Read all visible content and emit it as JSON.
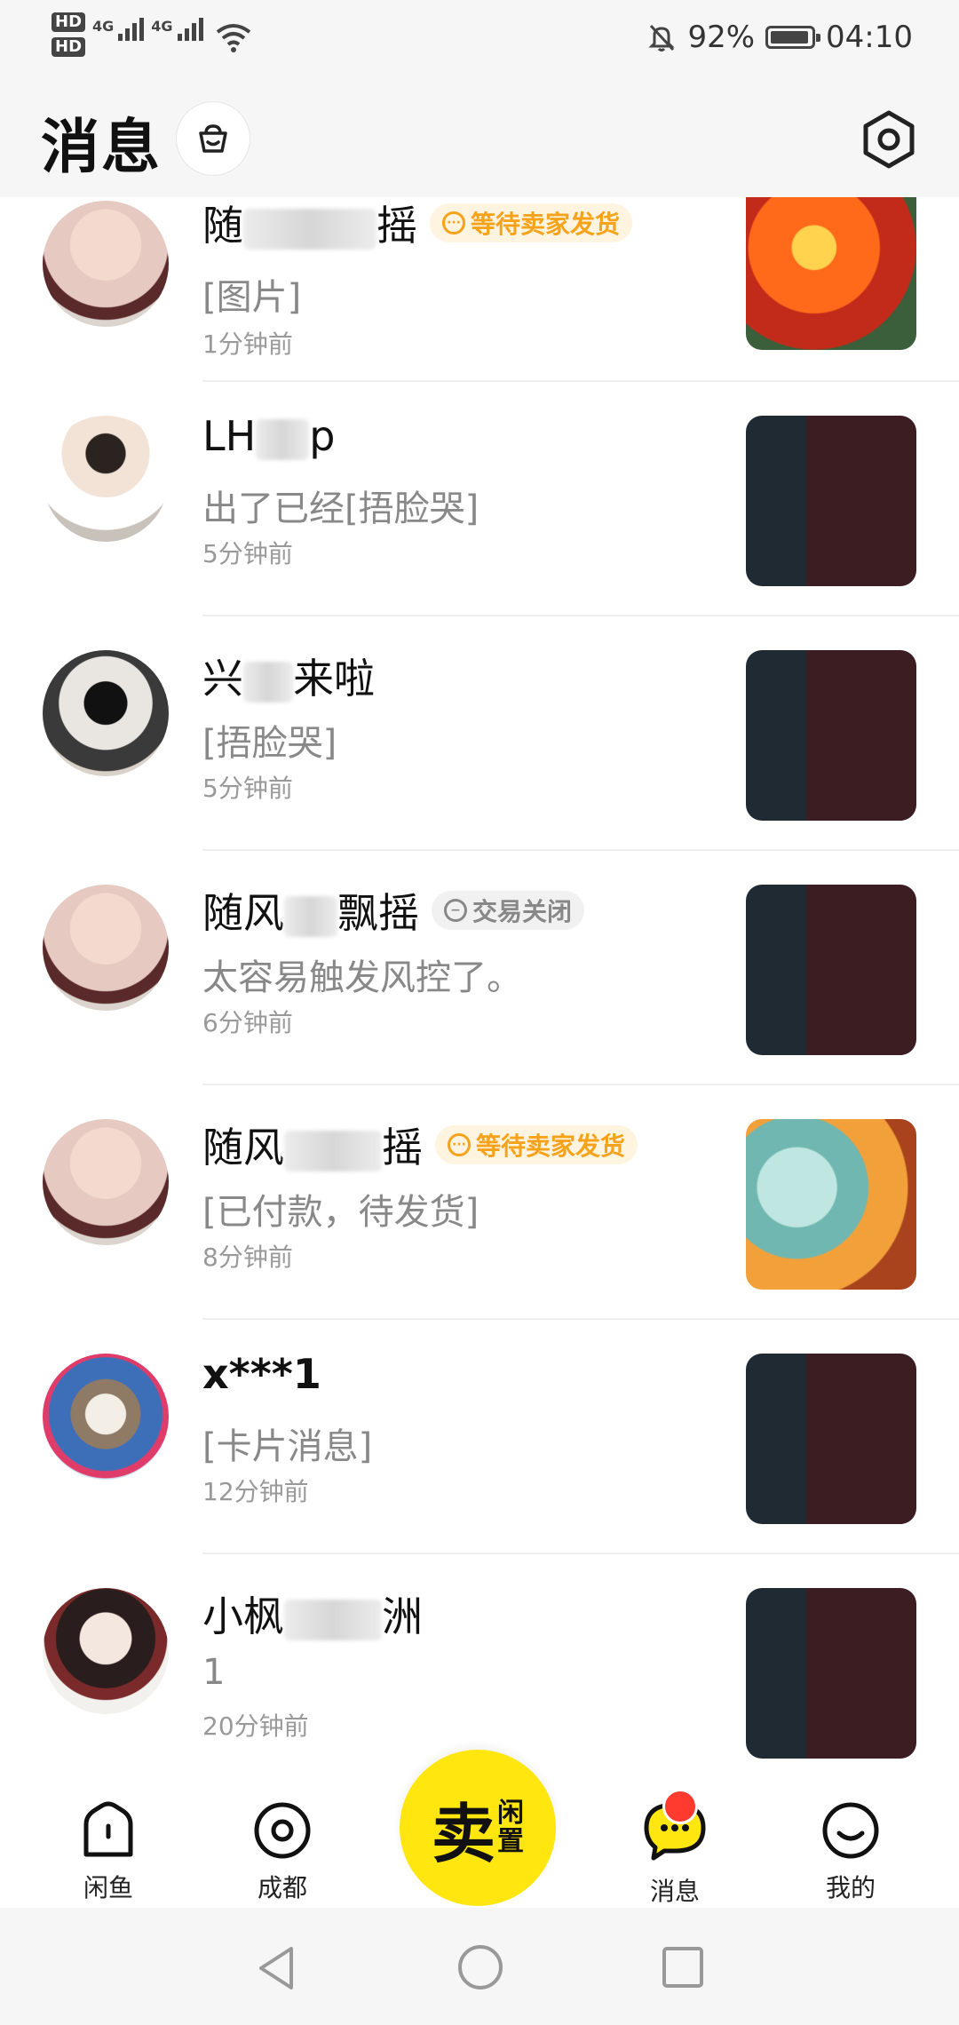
{
  "status_bar": {
    "sim1": "HD",
    "sim2": "HD",
    "net1": "4G",
    "net2": "4G",
    "battery": "92%",
    "time": "04:10"
  },
  "header": {
    "title": "消息"
  },
  "conversations": [
    {
      "name_pre": "随",
      "name_post": "摇",
      "badge": "等待卖家发货",
      "badge_type": "wait",
      "message": "[图片]",
      "time": "1分钟前"
    },
    {
      "name_pre": "LH",
      "name_post": "p",
      "badge": "",
      "badge_type": "",
      "message": "出了已经[捂脸哭]",
      "time": "5分钟前"
    },
    {
      "name_pre": "兴",
      "name_post": "来啦",
      "badge": "",
      "badge_type": "",
      "message": "[捂脸哭]",
      "time": "5分钟前"
    },
    {
      "name_pre": "随风",
      "name_post": "飘摇",
      "badge": "交易关闭",
      "badge_type": "closed",
      "message": "太容易触发风控了。",
      "time": "6分钟前"
    },
    {
      "name_pre": "随风",
      "name_post": "摇",
      "badge": "等待卖家发货",
      "badge_type": "wait",
      "message": "[已付款，待发货]",
      "time": "8分钟前"
    },
    {
      "name_pre": "x***1",
      "name_post": "",
      "badge": "",
      "badge_type": "",
      "message": "[卡片消息]",
      "time": "12分钟前"
    },
    {
      "name_pre": "小枫",
      "name_post": "洲",
      "badge": "",
      "badge_type": "",
      "message": "1",
      "time": "20分钟前"
    }
  ],
  "tabbar": {
    "home": "闲鱼",
    "city": "成都",
    "sell_big": "卖",
    "sell_small1": "闲",
    "sell_small2": "置",
    "messages": "消息",
    "mine": "我的"
  },
  "colors": {
    "accent_yellow": "#ffe60f",
    "badge_orange": "#f7a21b",
    "badge_gray": "#888888",
    "notification_red": "#ff3b30"
  }
}
